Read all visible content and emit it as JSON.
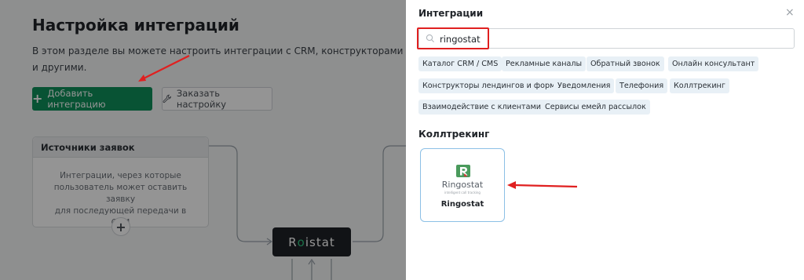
{
  "page": {
    "title": "Настройка интеграций",
    "description_line1": "В этом разделе вы можете настроить интеграции с CRM, конструкторами лендин",
    "description_line2": "и другими.",
    "add_button": "Добавить интеграцию",
    "order_button": "Заказать настройку"
  },
  "sources_card": {
    "title": "Источники заявок",
    "body_line1": "Интеграции, через которые",
    "body_line2": "пользователь может оставить заявку",
    "body_line3": "для последующей передачи в CRM",
    "add_symbol": "+"
  },
  "roistat_node": {
    "label_start": "R",
    "label_dot": "o",
    "label_end": "istat"
  },
  "panel": {
    "title": "Интеграции",
    "close_symbol": "×",
    "search": {
      "value": "ringostat",
      "placeholder": ""
    },
    "chips": [
      "Каталог CRM / CMS",
      "Рекламные каналы",
      "Обратный звонок",
      "Онлайн консультант",
      "Конструкторы лендингов и форм",
      "Уведомления",
      "Телефония",
      "Коллтрекинг",
      "Взаимодействие с клиентами",
      "Сервисы емейл рассылок"
    ],
    "section_title": "Коллтрекинг",
    "result_card": {
      "logo_text": "Ringostat",
      "logo_subtitle": "intelligent call tracking",
      "name": "Ringostat"
    }
  },
  "colors": {
    "primary_green": "#0f8f5a",
    "chip_bg": "#e8f0f6",
    "highlight_red": "#e02020",
    "logo_green": "#4a9a5c",
    "logo_red": "#d0393a"
  }
}
